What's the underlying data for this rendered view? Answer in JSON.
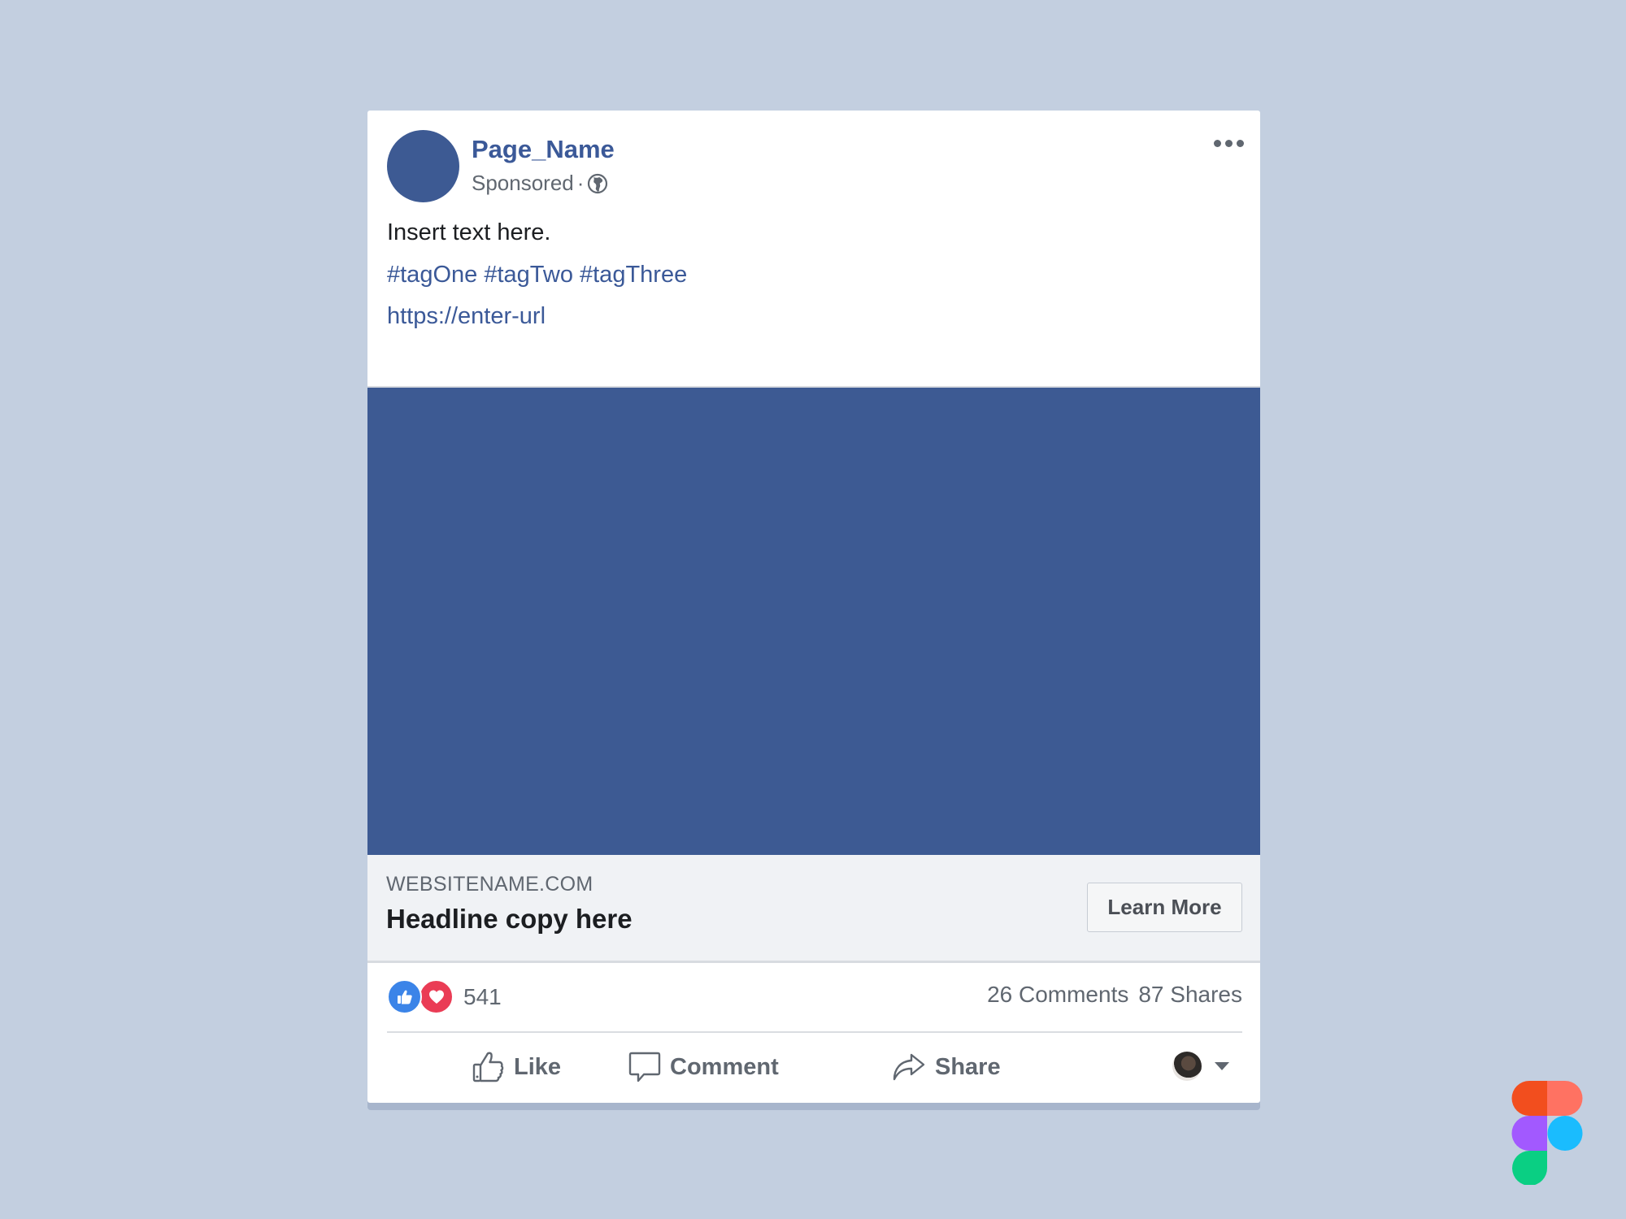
{
  "post": {
    "page_name": "Page_Name",
    "sponsored_label": "Sponsored",
    "separator": "·",
    "privacy_icon": "globe-icon",
    "more_icon": "more-options-icon",
    "body_text": "Insert text here.",
    "hashtags": "#tagOne #tagTwo #tagThree",
    "url": "https://enter-url"
  },
  "media": {
    "color": "#3d5a93"
  },
  "link_preview": {
    "site": "WEBSITENAME.COM",
    "headline": "Headline copy here",
    "cta_label": "Learn More"
  },
  "stats": {
    "reactions": [
      "like",
      "love"
    ],
    "reaction_count": "541",
    "comments": "26 Comments",
    "shares": "87 Shares"
  },
  "actions": {
    "like": "Like",
    "comment": "Comment",
    "share": "Share"
  },
  "colors": {
    "brand": "#3b5998",
    "background": "#c3cfe0",
    "like": "#3b84e8",
    "love": "#ea3c55"
  }
}
